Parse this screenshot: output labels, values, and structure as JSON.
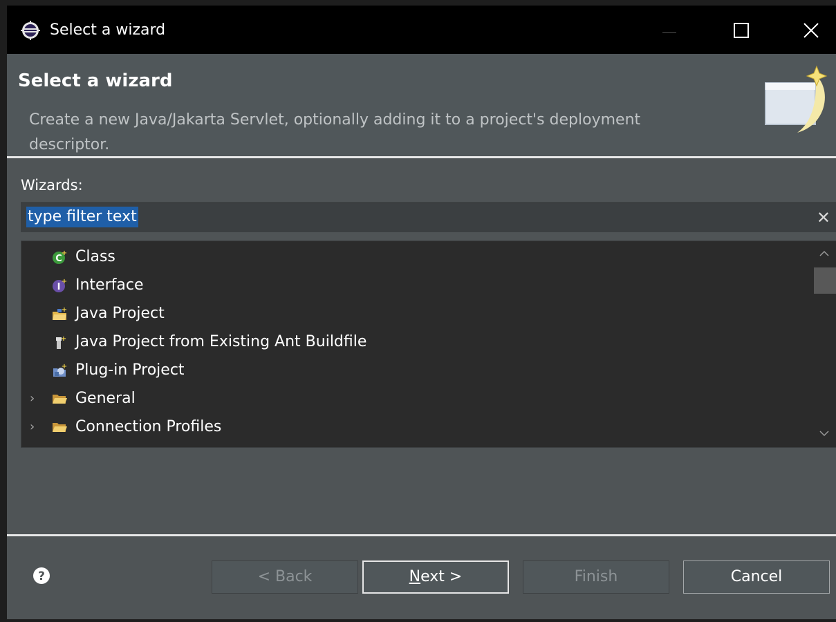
{
  "window": {
    "title": "Select a wizard"
  },
  "header": {
    "title": "Select a wizard",
    "description": "Create a new Java/Jakarta Servlet, optionally adding it to a project's deployment descriptor."
  },
  "wizards_label": "Wizards:",
  "filter": {
    "value": "type filter text",
    "clear_icon": "clear-icon"
  },
  "tree": {
    "items": [
      {
        "label": "Class",
        "icon": "class-icon",
        "expandable": false
      },
      {
        "label": "Interface",
        "icon": "interface-icon",
        "expandable": false
      },
      {
        "label": "Java Project",
        "icon": "java-project-icon",
        "expandable": false
      },
      {
        "label": "Java Project from Existing Ant Buildfile",
        "icon": "ant-buildfile-icon",
        "expandable": false
      },
      {
        "label": "Plug-in Project",
        "icon": "plugin-project-icon",
        "expandable": false
      },
      {
        "label": "General",
        "icon": "folder-icon",
        "expandable": true
      },
      {
        "label": "Connection Profiles",
        "icon": "folder-icon",
        "expandable": true
      }
    ]
  },
  "buttons": {
    "back": "< Back",
    "next_mnemonic": "N",
    "next_rest": "ext >",
    "finish": "Finish",
    "cancel": "Cancel"
  },
  "colors": {
    "titlebar": "#000000",
    "dialog_bg": "#4f5456",
    "tree_bg": "#2b2b2b",
    "selection": "#1f5fa8"
  }
}
